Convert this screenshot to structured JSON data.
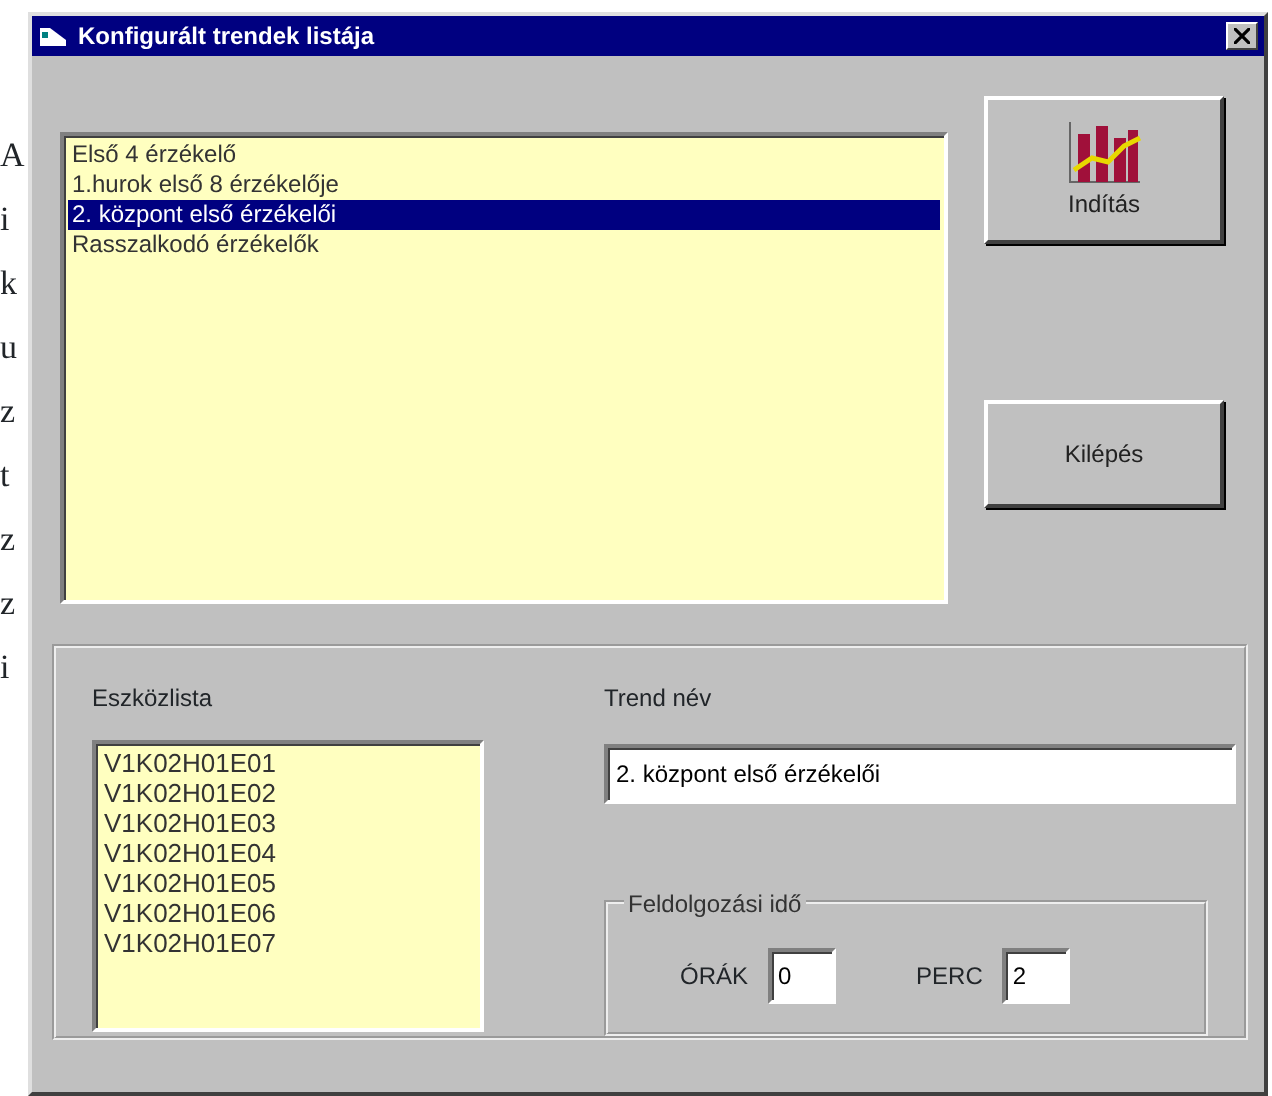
{
  "margin_text": [
    "A",
    "i",
    "k",
    "u",
    "z",
    "t",
    "z",
    "z",
    "i"
  ],
  "window": {
    "title": "Konfigurált trendek listája"
  },
  "trend_list": [
    {
      "label": "Első 4 érzékelő",
      "selected": false
    },
    {
      "label": "1.hurok első 8 érzékelője",
      "selected": false
    },
    {
      "label": "2. központ első érzékelői",
      "selected": true
    },
    {
      "label": "Rasszalkodó érzékelők",
      "selected": false
    }
  ],
  "buttons": [
    {
      "label": "Indítás",
      "kind": "chart"
    },
    {
      "label": "Kilépés",
      "kind": "plain"
    }
  ],
  "device_list": {
    "label": "Eszközlista",
    "items": [
      "V1K02H01E01",
      "V1K02H01E02",
      "V1K02H01E03",
      "V1K02H01E04",
      "V1K02H01E05",
      "V1K02H01E06",
      "V1K02H01E07"
    ]
  },
  "trend_name": {
    "label": "Trend név",
    "value": "2. központ első érzékelői"
  },
  "processing_time": {
    "label": "Feldolgozási idő",
    "hours_label": "ÓRÁK",
    "hours": "0",
    "minutes_label": "PERC",
    "minutes": "2"
  }
}
